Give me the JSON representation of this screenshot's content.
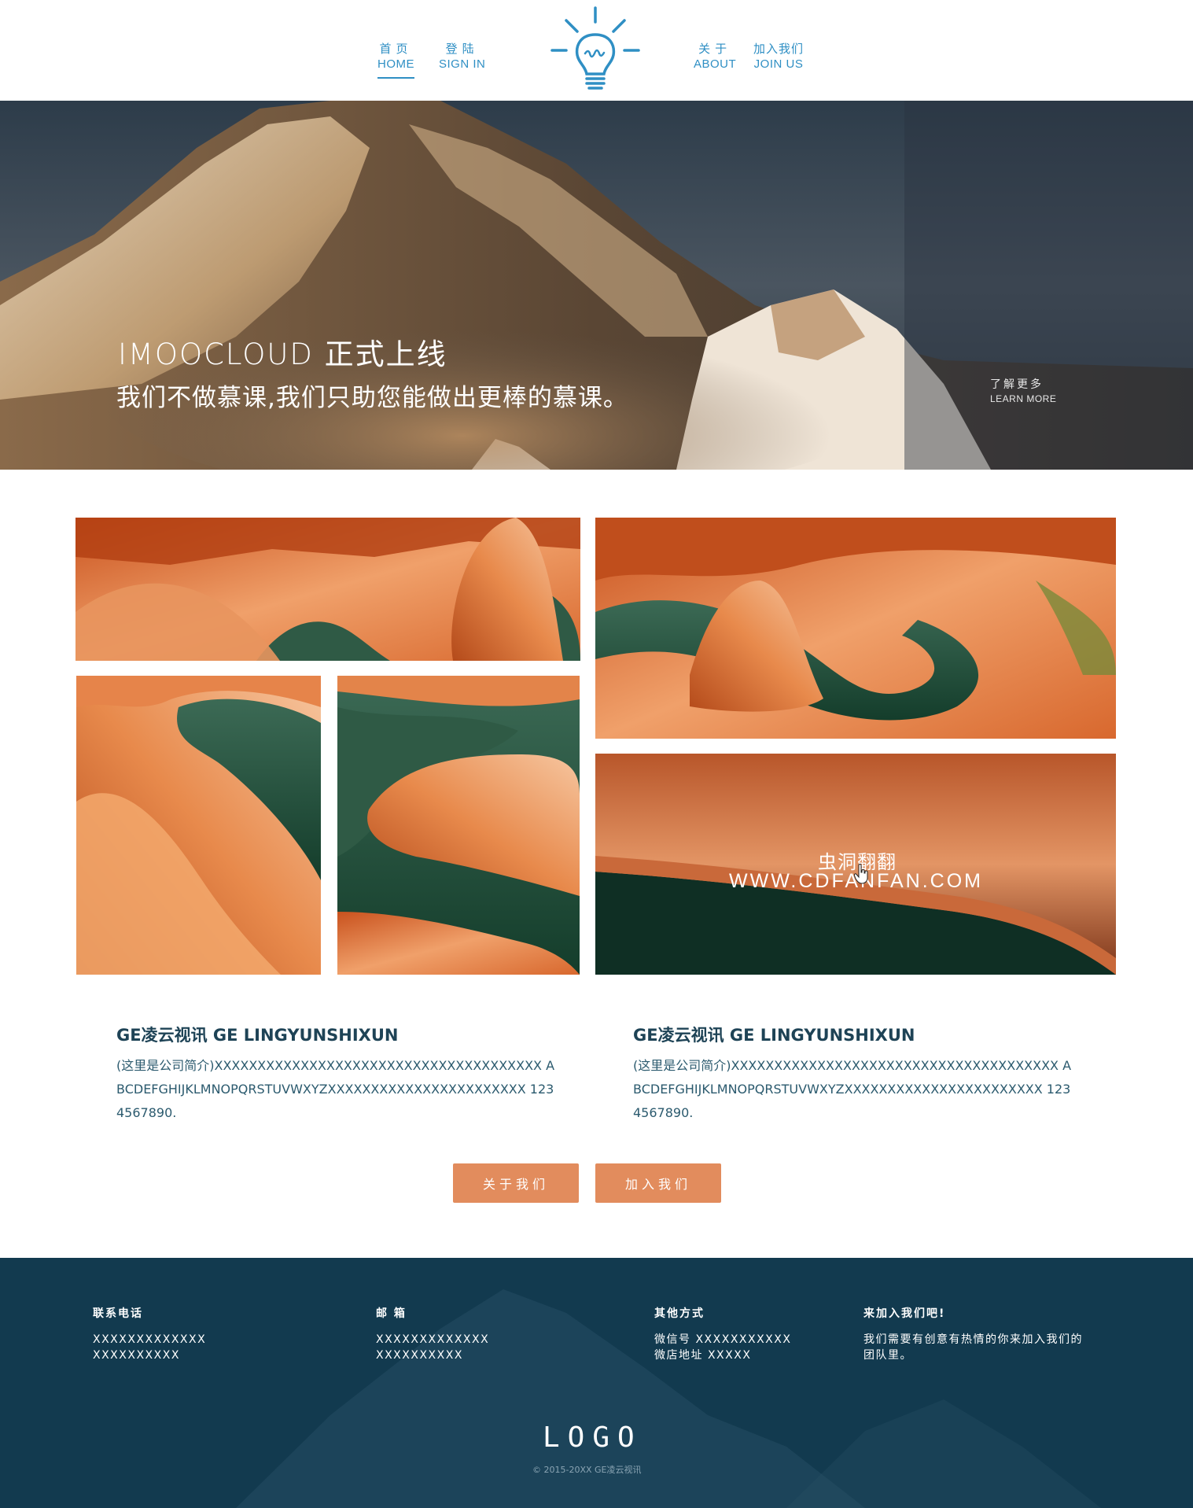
{
  "nav": {
    "home": {
      "cn": "首页",
      "en": "HOME"
    },
    "signin": {
      "cn": "登陆",
      "en": "SIGN IN"
    },
    "about": {
      "cn": "关于",
      "en": "ABOUT"
    },
    "join": {
      "cn": "加入我们",
      "en": "JOIN US"
    }
  },
  "hero": {
    "title": "IMOOCLOUD 正式上线",
    "subtitle": "我们不做慕课,我们只助您能做出更棒的慕课。",
    "learn_more_cn": "了解更多",
    "learn_more_en": "LEARN MORE"
  },
  "gallery": {
    "watermark_cn": "虫洞翻翻",
    "watermark_url": "WWW.CDFANFAN.COM"
  },
  "intro": [
    {
      "title": "GE凌云视讯 GE LINGYUNSHIXUN",
      "text": "(这里是公司简介)XXXXXXXXXXXXXXXXXXXXXXXXXXXXXXXXXXXXXX ABCDEFGHIJKLMNOPQRSTUVWXYZXXXXXXXXXXXXXXXXXXXXXXX 1234567890."
    },
    {
      "title": "GE凌云视讯 GE LINGYUNSHIXUN",
      "text": "(这里是公司简介)XXXXXXXXXXXXXXXXXXXXXXXXXXXXXXXXXXXXXX ABCDEFGHIJKLMNOPQRSTUVWXYZXXXXXXXXXXXXXXXXXXXXXXX 1234567890."
    }
  ],
  "buttons": {
    "about": "关于我们",
    "join": "加入我们"
  },
  "footer": {
    "phone": {
      "head": "联系电话",
      "lines": [
        "XXXXXXXXXXXXX",
        "XXXXXXXXXX"
      ]
    },
    "email": {
      "head": "邮 箱",
      "lines": [
        "XXXXXXXXXXXXX",
        "XXXXXXXXXX"
      ]
    },
    "other": {
      "head": "其他方式",
      "lines": [
        "微信号 XXXXXXXXXXX",
        "微店地址 XXXXX"
      ]
    },
    "join": {
      "head": "来加入我们吧!",
      "lines": [
        "我们需要有创意有热情的你来加入我们的",
        "团队里。"
      ]
    },
    "logo": "LOGO",
    "copyright": "© 2015-20XX GE凌云视讯"
  },
  "colors": {
    "nav_blue": "#2f8fc4",
    "button_orange": "#e28c5d",
    "footer_bg": "#123a4f",
    "heading_dark": "#1e4356"
  }
}
